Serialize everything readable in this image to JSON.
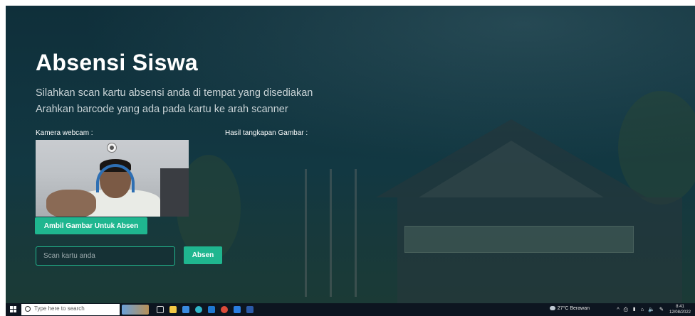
{
  "page": {
    "title": "Absensi Siswa",
    "subtitle_line1": "Silahkan scan kartu absensi anda di tempat yang disediakan",
    "subtitle_line2": "Arahkan barcode yang ada pada kartu ke arah scanner"
  },
  "camera": {
    "label": "Kamera webcam :",
    "capture_button": "Ambil Gambar Untuk Absen"
  },
  "result": {
    "label": "Hasil tangkapan Gambar :"
  },
  "scan": {
    "placeholder": "Scan kartu anda",
    "submit_button": "Absen"
  },
  "colors": {
    "accent": "#1fb68f",
    "background": "#11343f",
    "taskbar": "#0d1520"
  },
  "taskbar": {
    "search_placeholder": "Type here to search",
    "weather": "27°C  Berawan",
    "tray_icons": "^ ⎙ ▮ ⌂ 🔈 ✎",
    "time": "8:41",
    "date": "12/08/2022",
    "apps": [
      "task-view",
      "file-explorer",
      "store",
      "edge",
      "mail",
      "chrome",
      "app",
      "word"
    ]
  }
}
